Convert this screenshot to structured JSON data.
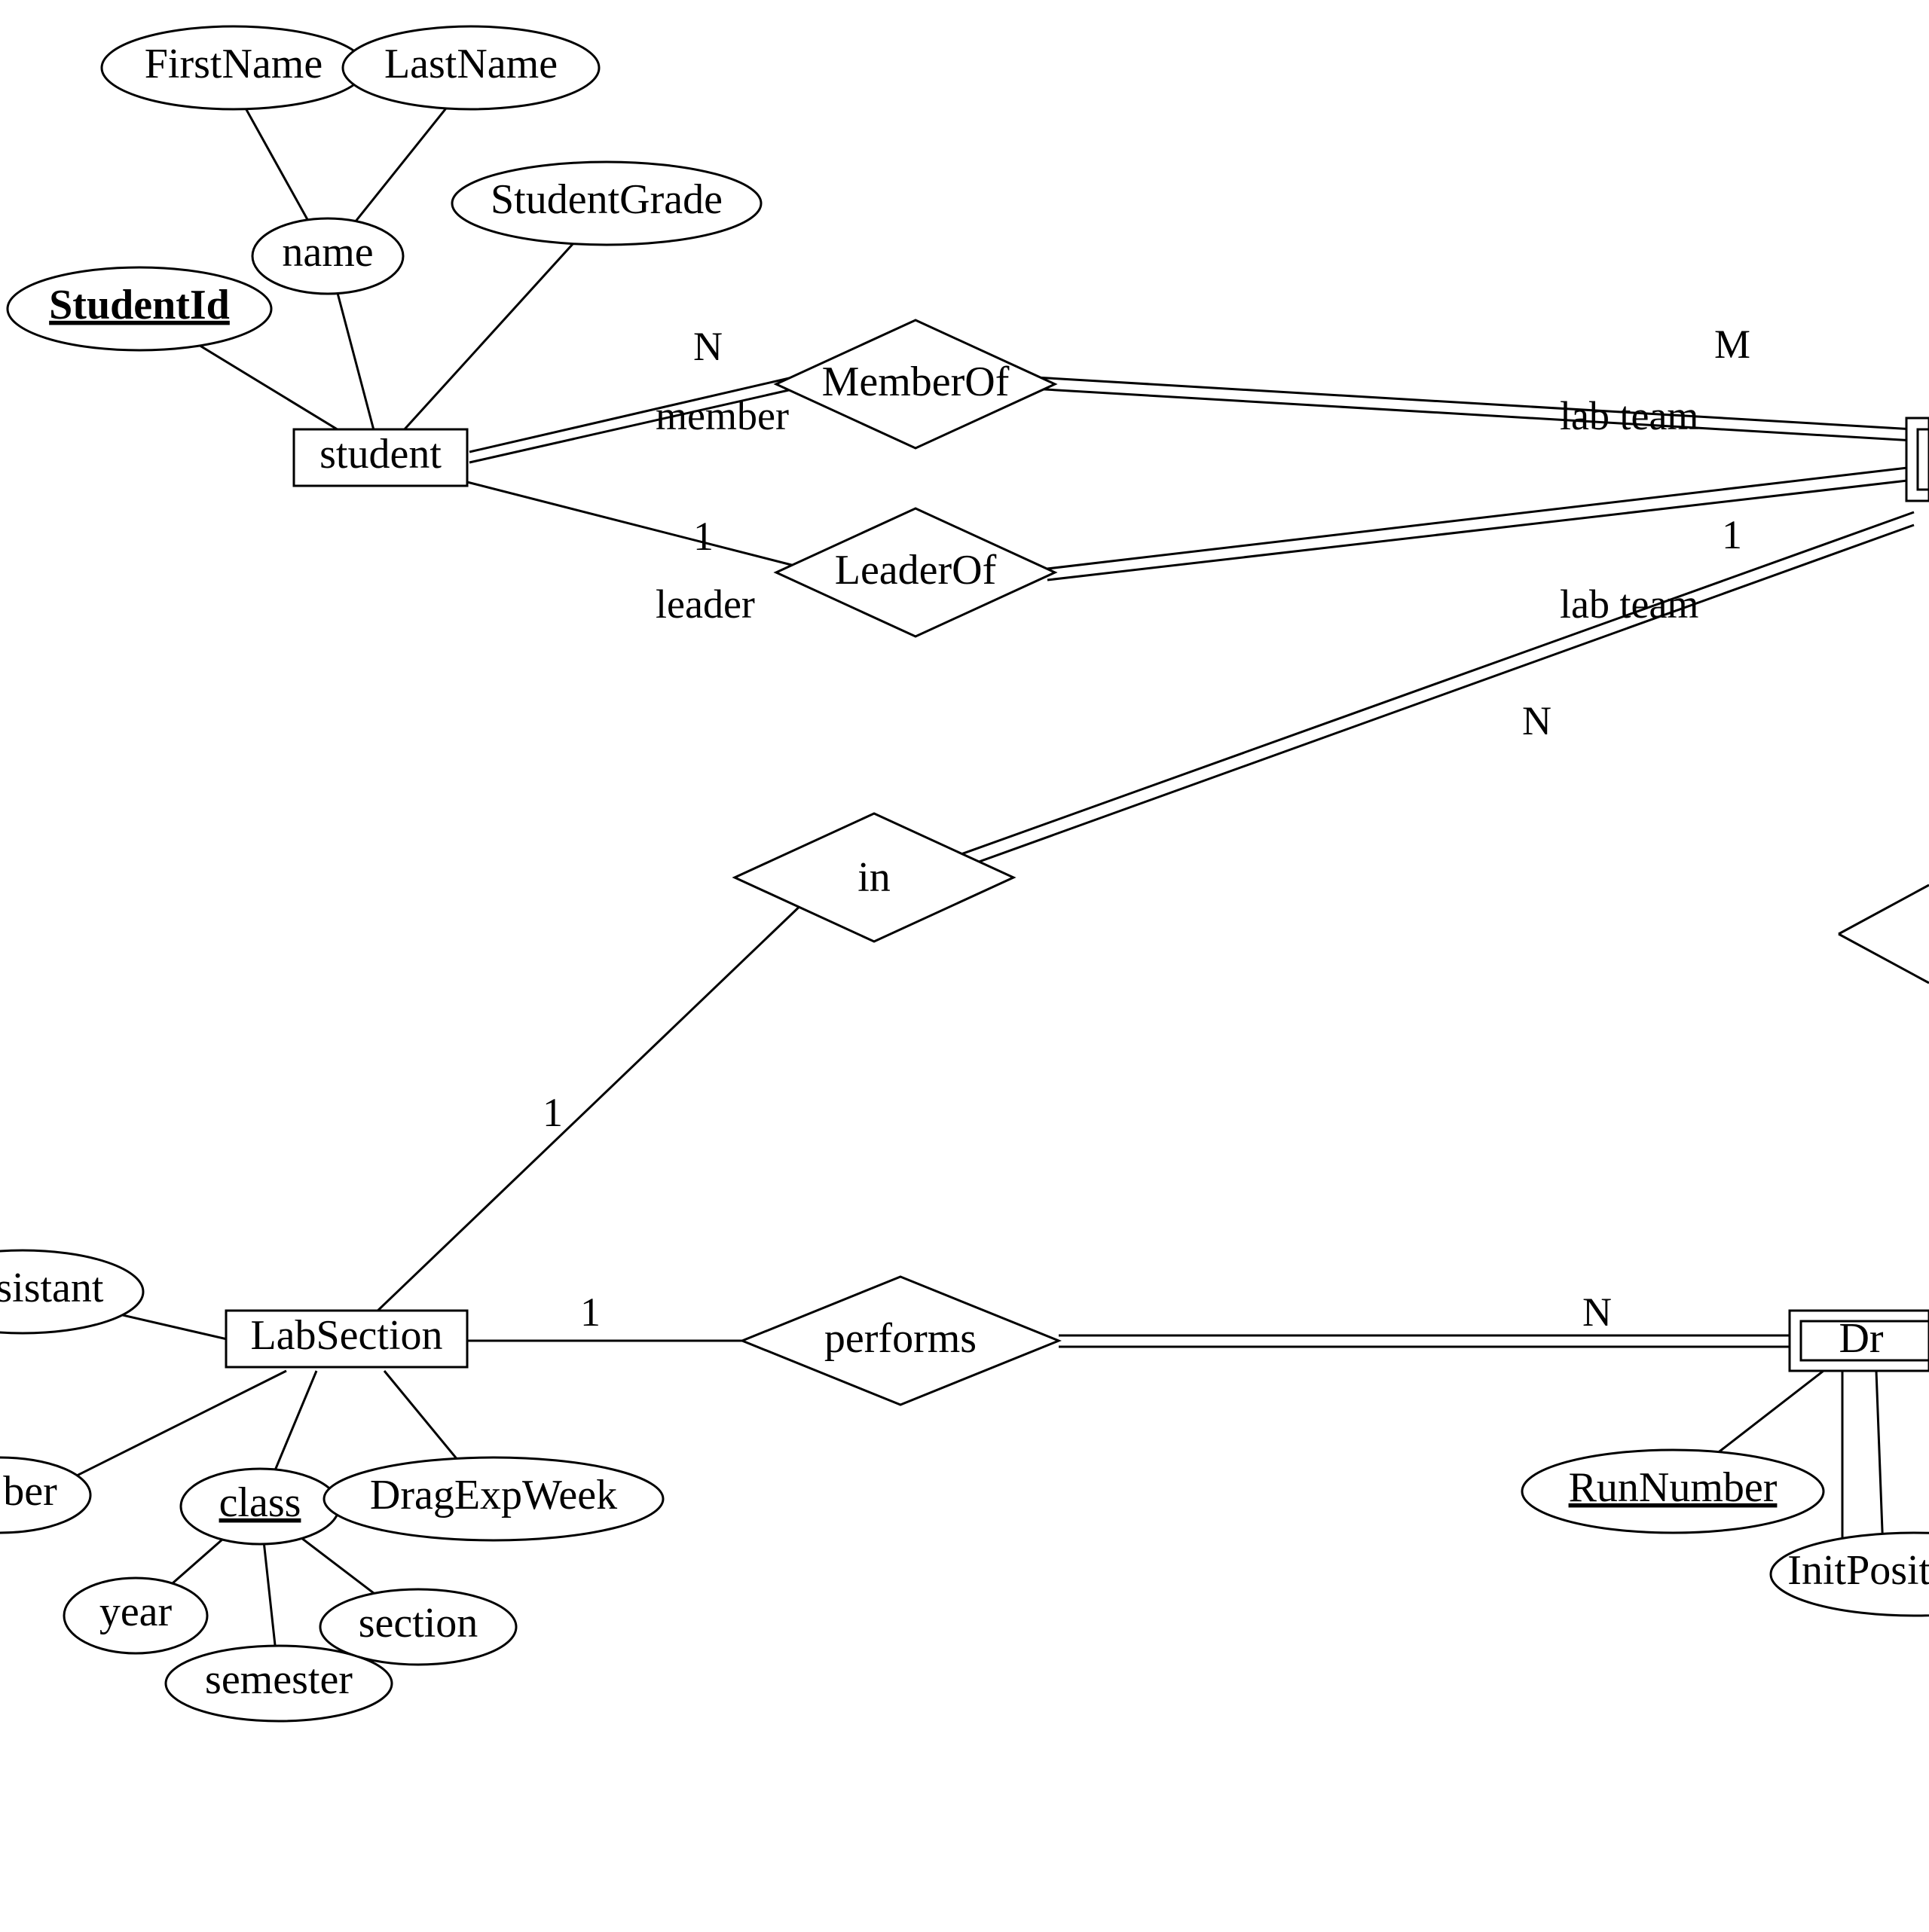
{
  "diagram": {
    "type": "entity-relationship",
    "entities": {
      "student": {
        "label": "student"
      },
      "labSection": {
        "label": "LabSection"
      },
      "dragExp": {
        "label": "Dr"
      },
      "labTeam": {
        "label": ""
      }
    },
    "attributes": {
      "firstName": {
        "label": "FirstName"
      },
      "lastName": {
        "label": "LastName"
      },
      "name": {
        "label": "name"
      },
      "studentId": {
        "label": "StudentId",
        "key": true
      },
      "studentGrade": {
        "label": "StudentGrade"
      },
      "assistant": {
        "label": "ssistant"
      },
      "ber": {
        "label": "ber"
      },
      "class": {
        "label": "class",
        "composite": true
      },
      "year": {
        "label": "year"
      },
      "semester": {
        "label": "semester"
      },
      "section": {
        "label": "section"
      },
      "dragExpWeek": {
        "label": "DragExpWeek"
      },
      "runNumber": {
        "label": "RunNumber",
        "key": true
      },
      "initPosition": {
        "label": "InitPositi"
      }
    },
    "relationships": {
      "memberOf": {
        "label": "MemberOf"
      },
      "leaderOf": {
        "label": "LeaderOf"
      },
      "in": {
        "label": "in"
      },
      "performs": {
        "label": "performs"
      }
    },
    "roles": {
      "member": "member",
      "leader": "leader",
      "labTeam1": "lab team",
      "labTeam2": "lab team"
    },
    "cardinalities": {
      "N": "N",
      "M": "M",
      "one": "1"
    }
  }
}
